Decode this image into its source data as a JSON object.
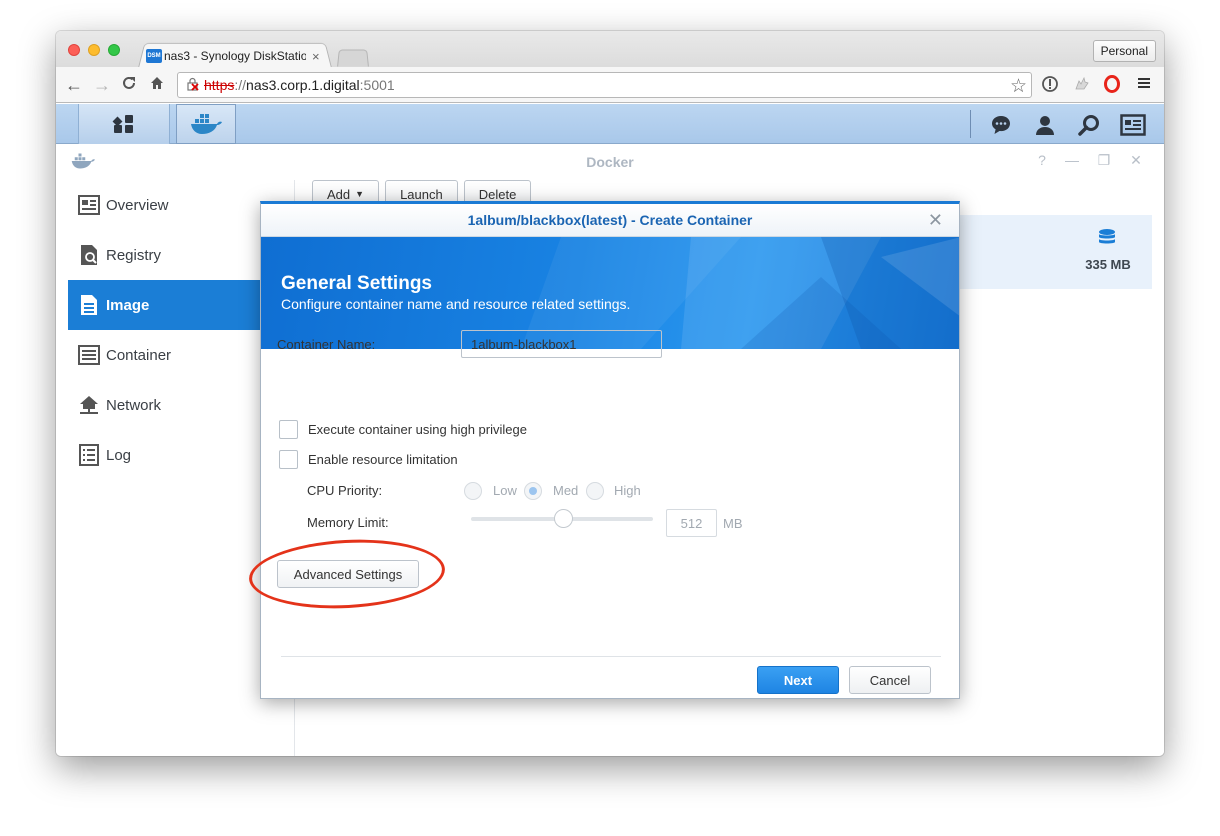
{
  "browser": {
    "tab_title": "nas3 - Synology DiskStatio",
    "tab_favicon_text": "DSM",
    "tab_close": "×",
    "profile_button": "Personal",
    "url": {
      "scheme": "https",
      "separator": "://",
      "host": "nas3.corp.1.digital",
      "port": ":5001"
    }
  },
  "dsm": {
    "window_title": "Docker",
    "sidebar": {
      "items": [
        {
          "label": "Overview",
          "icon": "overview-icon"
        },
        {
          "label": "Registry",
          "icon": "registry-icon"
        },
        {
          "label": "Image",
          "icon": "image-icon",
          "active": true
        },
        {
          "label": "Container",
          "icon": "container-icon"
        },
        {
          "label": "Network",
          "icon": "network-icon"
        },
        {
          "label": "Log",
          "icon": "log-icon"
        }
      ]
    },
    "toolbar": {
      "add": "Add",
      "launch": "Launch",
      "delete": "Delete"
    },
    "image_row": {
      "size": "335 MB"
    }
  },
  "modal": {
    "title": "1album/blackbox(latest) - Create Container",
    "banner_title": "General Settings",
    "banner_subtitle": "Configure container name and resource related settings.",
    "container_name_label": "Container Name:",
    "container_name_value": "1album-blackbox1",
    "high_privilege_label": "Execute container using high privilege",
    "resource_limit_label": "Enable resource limitation",
    "cpu_priority_label": "CPU Priority:",
    "cpu_options": [
      "Low",
      "Med",
      "High"
    ],
    "cpu_selected": "Med",
    "memory_limit_label": "Memory Limit:",
    "memory_value": "512",
    "memory_unit": "MB",
    "advanced_button": "Advanced Settings",
    "next_button": "Next",
    "cancel_button": "Cancel"
  },
  "colors": {
    "accent": "#1b7ed6",
    "annotation": "#e4331a"
  }
}
